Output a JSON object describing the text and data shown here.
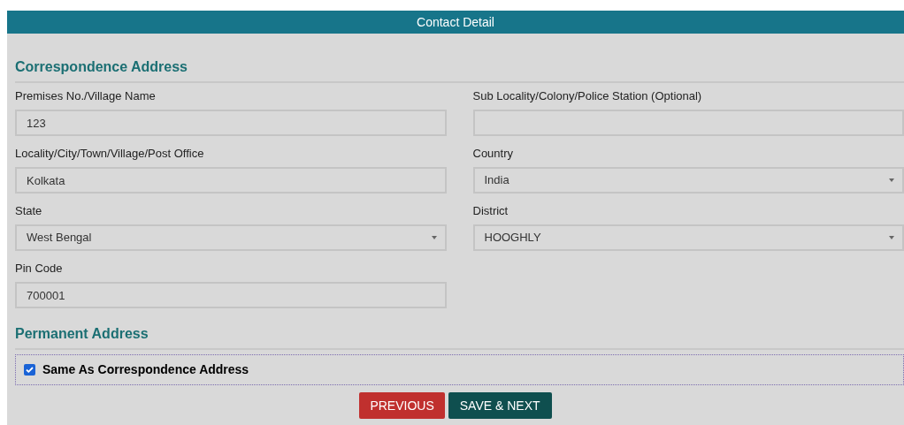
{
  "header": {
    "title": "Contact Detail"
  },
  "correspondence": {
    "title": "Correspondence Address",
    "fields": [
      {
        "kind": "text",
        "label": "Premises No./Village Name",
        "value": "123"
      },
      {
        "kind": "text",
        "label": "Sub Locality/Colony/Police Station (Optional)"
      },
      {
        "kind": "text",
        "label": "Locality/City/Town/Village/Post Office",
        "value": "Kolkata"
      },
      {
        "kind": "select",
        "label": "Country",
        "value": "India"
      },
      {
        "kind": "select",
        "label": "State",
        "value": "West Bengal"
      },
      {
        "kind": "select",
        "label": "District",
        "value": "HOOGHLY"
      },
      {
        "kind": "text",
        "label": "Pin Code",
        "value": "700001"
      }
    ]
  },
  "permanent": {
    "title": "Permanent Address",
    "same_as": {
      "label": "Same As Correspondence Address",
      "checked": true
    }
  },
  "buttons": [
    {
      "kind": "secondary",
      "label": "PREVIOUS"
    },
    {
      "kind": "primary",
      "label": "SAVE & NEXT"
    }
  ]
}
